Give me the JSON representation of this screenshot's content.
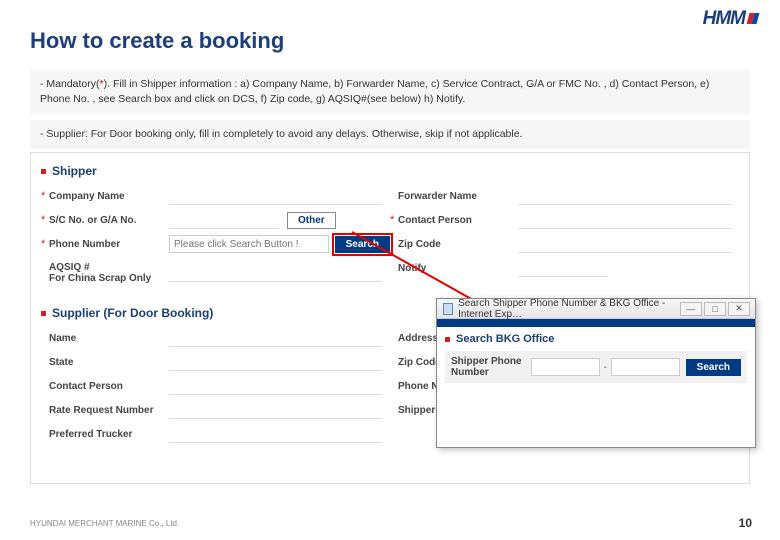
{
  "logo": {
    "text": "HMM"
  },
  "title": "How to create a booking",
  "notes": {
    "n1a": "- Mandatory(",
    "n1ast": "*",
    "n1b": "). Fill in Shipper information : a) Company Name, b) Forwarder Name, c) Service Contract, G/A or FMC No. , d) Contact Person, e) Phone No. , see Search box and click on DCS, f) Zip code, g) AQSIQ#(see below) h) Notify.",
    "n2": "- Supplier: For Door booking only, fill in completely to avoid any delays. Otherwise, skip if not applicable."
  },
  "app": {
    "shipper_head": "Shipper",
    "supplier_head": "Supplier (For Door Booking)",
    "star": "*",
    "labels": {
      "company": "Company Name",
      "sc": "S/C No. or G/A No.",
      "phone": "Phone Number",
      "aqsiq": "AQSIQ #",
      "aqsiq2": "For China Scrap Only",
      "fwd": "Forwarder Name",
      "contact": "Contact Person",
      "zip": "Zip Code",
      "notify": "Notify",
      "name": "Name",
      "state": "State",
      "contactp": "Contact Person",
      "rate": "Rate Request Number",
      "truck": "Preferred Trucker",
      "address": "Address",
      "zip2": "Zip Code",
      "phone2": "Phone Number",
      "shref": "Shipper Ref Number"
    },
    "placeholder_phone": "Please click Search Button !",
    "btn_other": "Other",
    "btn_search": "Search"
  },
  "popup": {
    "title": "Search Shipper Phone Number & BKG Office - Internet Exp…",
    "section": "Search BKG Office",
    "plabel": "Shipper Phone Number",
    "dash": "-",
    "btn": "Search",
    "min": "—",
    "max": "□",
    "close": "✕"
  },
  "footer": {
    "left": "HYUNDAI MERCHANT MARINE Co., Ltd.",
    "page": "10"
  }
}
